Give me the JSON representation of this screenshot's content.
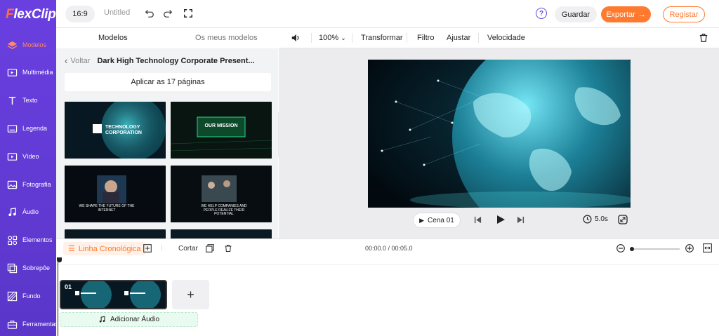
{
  "brand": {
    "logo_f": "F",
    "logo_rest": "lexClip"
  },
  "sidebar": {
    "items": [
      {
        "label": "Modelos",
        "icon": "layers-icon",
        "active": true
      },
      {
        "label": "Multimédia",
        "icon": "media-icon"
      },
      {
        "label": "Texto",
        "icon": "text-icon"
      },
      {
        "label": "Legenda",
        "icon": "subtitle-icon"
      },
      {
        "label": "Vídeo",
        "icon": "video-icon"
      },
      {
        "label": "Fotografia",
        "icon": "photo-icon"
      },
      {
        "label": "Áudio",
        "icon": "music-icon"
      },
      {
        "label": "Elementos",
        "icon": "elements-icon"
      },
      {
        "label": "Sobrepôe",
        "icon": "overlay-icon"
      },
      {
        "label": "Fundo",
        "icon": "background-icon"
      },
      {
        "label": "Ferramentas",
        "icon": "toolbox-icon"
      }
    ]
  },
  "topbar": {
    "ratio": "16:9",
    "title": "Untitled",
    "help": "?",
    "save": "Guardar",
    "export": "Exportar",
    "register": "Registar"
  },
  "panel": {
    "tabs": [
      "Modelos",
      "Os meus modelos"
    ],
    "back": "Voltar",
    "template_name": "Dark High Technology Corporate Present...",
    "apply": "Aplicar as 17 páginas",
    "thumbs": [
      {
        "title": "TECHNOLOGY CORPORATION"
      },
      {
        "title": "OUR MISSION"
      },
      {
        "title": "WE SHAPE THE FUTURE OF THE INTERNET"
      },
      {
        "title": "WE HELP COMPANIES AND PEOPLE REALIZE THEIR POTENTIAL"
      }
    ]
  },
  "editor_toolbar": {
    "zoom": "100%",
    "items": [
      "Transformar",
      "Filtro",
      "Ajustar",
      "Velocidade"
    ]
  },
  "player": {
    "scene": "Cena 01",
    "duration": "5.0s"
  },
  "timeline": {
    "label": "Linha Cronológica",
    "cut": "Cortar",
    "time": "00:00.0 / 00:05.0",
    "zoom_level": 0.0,
    "clip_number": "01",
    "add_audio": "Adicionar Áudio"
  },
  "colors": {
    "accent": "#ff7a2e",
    "sidebar": "#6a3fe0",
    "brand_purple": "#5b4dd6"
  }
}
